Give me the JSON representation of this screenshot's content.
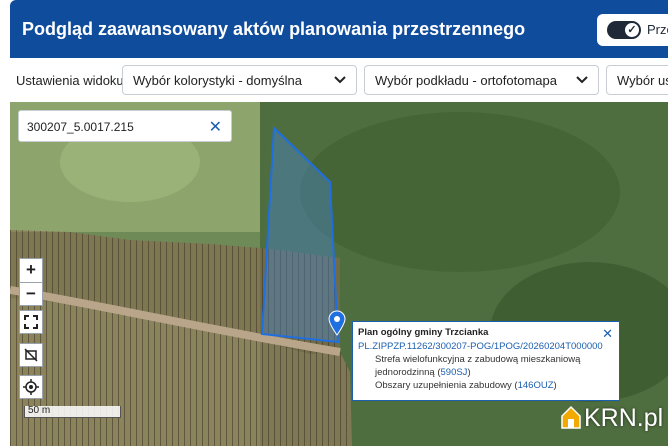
{
  "header": {
    "title": "Podgląd zaawansowany aktów planowania przestrzennego",
    "toggle_label": "Prze"
  },
  "toolbar": {
    "label": "Ustawienia widoku",
    "color_select": "Wybór kolorystyki - domyślna",
    "base_select": "Wybór podkładu - ortofotomapa",
    "extra_select": "Wybór usł"
  },
  "search": {
    "value": "300207_5.0017.215"
  },
  "zoom": {
    "in": "+",
    "out": "−"
  },
  "scale": {
    "label": "50 m"
  },
  "popup": {
    "title": "Plan ogólny gminy Trzcianka",
    "link": "PL.ZIPPZP.11262/300207-POG/1POG/20260204T000000",
    "zone_text_1": "Strefa wielofunkcyjna z zabudową mieszkaniową",
    "zone_text_2": "jednorodzinną (",
    "zone_code": "590SJ",
    "zone_close": ")",
    "area_text": "Obszary uzupełnienia zabudowy (",
    "area_code": "146OUZ",
    "area_close": ")"
  },
  "watermark": {
    "text": "KRN.pl"
  },
  "colors": {
    "header": "#0f4c9c",
    "accent": "#1b5fb0"
  },
  "icons": [
    "chevron-down-icon",
    "close-icon",
    "fullscreen-icon",
    "layer-hide-icon",
    "locate-icon",
    "map-pin-icon",
    "toggle-check-icon",
    "house-logo-icon"
  ]
}
